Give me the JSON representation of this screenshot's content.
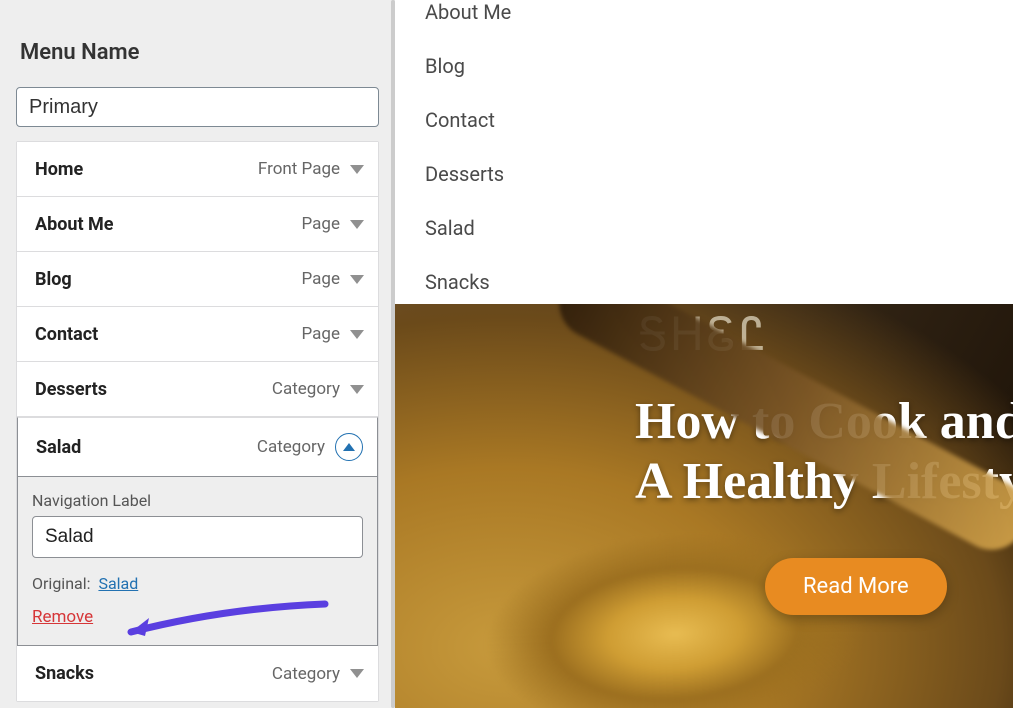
{
  "panel": {
    "title": "Menu Name",
    "menu_name": "Primary",
    "items": [
      {
        "label": "Home",
        "type": "Front Page"
      },
      {
        "label": "About Me",
        "type": "Page"
      },
      {
        "label": "Blog",
        "type": "Page"
      },
      {
        "label": "Contact",
        "type": "Page"
      },
      {
        "label": "Desserts",
        "type": "Category"
      },
      {
        "label": "Salad",
        "type": "Category"
      },
      {
        "label": "Snacks",
        "type": "Category"
      }
    ],
    "expanded": {
      "nav_label_heading": "Navigation Label",
      "nav_label_value": "Salad",
      "original_prefix": "Original:",
      "original_link": "Salad",
      "remove": "Remove"
    }
  },
  "preview": {
    "nav": [
      "About Me",
      "Blog",
      "Contact",
      "Desserts",
      "Salad",
      "Snacks"
    ],
    "wordmark": "ᎦᎻᏋᏝ",
    "hero_line1": "How to Cook and L",
    "hero_line2": "A Healthy Lifestyl",
    "cta": "Read More"
  },
  "colors": {
    "link_blue": "#2271b1",
    "danger_red": "#d63638",
    "cta_orange": "#e88b21",
    "annotation_purple": "#5a3fe0"
  }
}
